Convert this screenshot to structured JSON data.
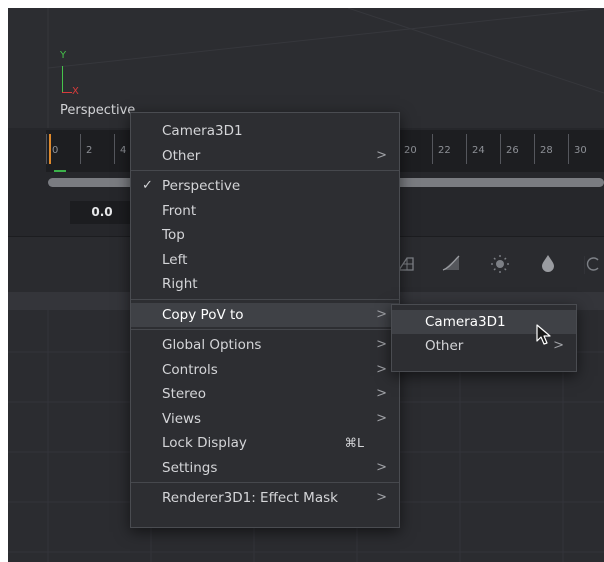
{
  "viewer": {
    "axis_y": "Y",
    "axis_x": "X",
    "view_label": "Perspective"
  },
  "ruler": {
    "ticks": [
      "0",
      "2",
      "4",
      "20",
      "22",
      "24",
      "26",
      "28",
      "30"
    ],
    "time_value": "0.0"
  },
  "toolbar": {
    "icons": [
      "grid-icon",
      "curve-icon",
      "brightness-icon",
      "drop-icon",
      "rotate-icon"
    ]
  },
  "main_menu": {
    "camera": "Camera3D1",
    "other": "Other",
    "perspective": "Perspective",
    "front": "Front",
    "top": "Top",
    "left": "Left",
    "right": "Right",
    "copy_pov": "Copy PoV to",
    "global_options": "Global Options",
    "controls": "Controls",
    "stereo": "Stereo",
    "views": "Views",
    "lock_display": "Lock Display",
    "lock_shortcut": "⌘L",
    "settings": "Settings",
    "renderer": "Renderer3D1: Effect Mask",
    "check_mark": "✓",
    "arrow": ">"
  },
  "sub_menu": {
    "camera": "Camera3D1",
    "other": "Other"
  }
}
